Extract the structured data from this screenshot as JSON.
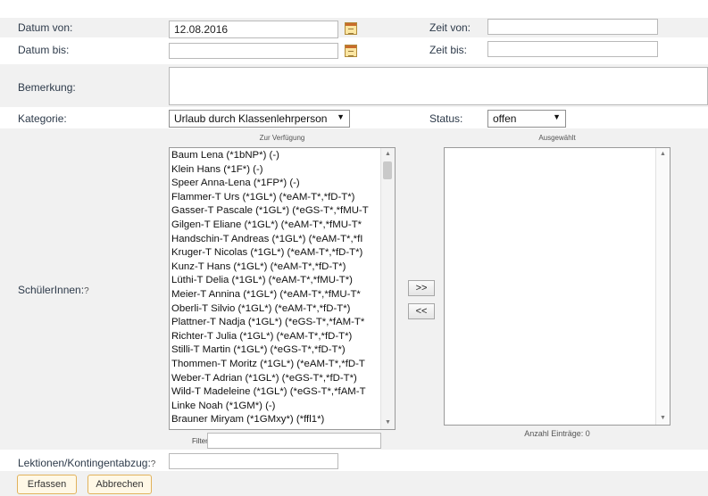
{
  "form": {
    "datum_von": {
      "label": "Datum von:",
      "value": "12.08.2016"
    },
    "datum_bis": {
      "label": "Datum bis:",
      "value": ""
    },
    "zeit_von": {
      "label": "Zeit von:",
      "value": ""
    },
    "zeit_bis": {
      "label": "Zeit bis:",
      "value": ""
    },
    "bemerkung": {
      "label": "Bemerkung:",
      "value": ""
    },
    "kategorie": {
      "label": "Kategorie:",
      "selected": "Urlaub durch Klassenlehrperson"
    },
    "status": {
      "label": "Status:",
      "selected": "offen"
    },
    "schueler": {
      "label": "SchülerInnen:",
      "help": "?",
      "available_caption": "Zur Verfügung",
      "selected_caption": "Ausgewählt",
      "available": [
        "Baum Lena (*1bNP*) (-)",
        "Klein Hans (*1F*) (-)",
        "Speer Anna-Lena (*1FP*) (-)",
        "Flammer-T Urs (*1GL*) (*eAM-T*,*fD-T*)",
        "Gasser-T Pascale (*1GL*) (*eGS-T*,*fMU-T",
        "Gilgen-T Eliane (*1GL*) (*eAM-T*,*fMU-T*",
        "Handschin-T Andreas (*1GL*) (*eAM-T*,*fI",
        "Kruger-T Nicolas (*1GL*) (*eAM-T*,*fD-T*)",
        "Kunz-T Hans (*1GL*) (*eAM-T*,*fD-T*)",
        "Lüthi-T Delia (*1GL*) (*eAM-T*,*fMU-T*)",
        "Meier-T Annina (*1GL*) (*eAM-T*,*fMU-T*",
        "Oberli-T Silvio (*1GL*) (*eAM-T*,*fD-T*)",
        "Plattner-T Nadja (*1GL*) (*eGS-T*,*fAM-T*",
        "Richter-T Julia (*1GL*) (*eAM-T*,*fD-T*)",
        "Stilli-T Martin (*1GL*) (*eGS-T*,*fD-T*)",
        "Thommen-T Moritz (*1GL*) (*eAM-T*,*fD-T",
        "Weber-T Adrian (*1GL*) (*eGS-T*,*fD-T*)",
        "Wild-T Madeleine (*1GL*) (*eGS-T*,*fAM-T",
        "Linke Noah (*1GM*) (-)",
        "Brauner Miryam (*1GMxy*) (*ffl1*)"
      ],
      "add_label": ">>",
      "remove_label": "<<",
      "filter_label": "Filter:",
      "filter_value": "",
      "count_text": "Anzahl Einträge: 0"
    },
    "lektionen": {
      "label": "Lektionen/Kontingentabzug:",
      "help": "?",
      "value": ""
    }
  },
  "actions": {
    "submit_label": "Erfassen",
    "cancel_label": "Abbrechen"
  },
  "colors": {
    "row_bg": "#f1f1f1",
    "button_border": "#e1b25b",
    "label_text": "#2d3a4a"
  }
}
